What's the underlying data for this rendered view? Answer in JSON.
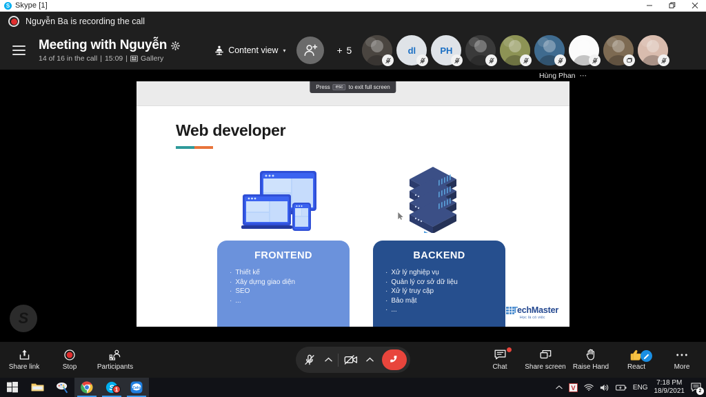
{
  "window": {
    "app_title": "Skype [1]",
    "app_badge": "S",
    "minimize": "–",
    "restore": "❐",
    "close": "✕"
  },
  "recording": {
    "text": "Nguyễn Ba is recording the call"
  },
  "header": {
    "title": "Meeting with Nguyễn",
    "subtitle_participants": "14 of 16 in the call",
    "subtitle_sep1": "|",
    "subtitle_time": "15:09",
    "subtitle_sep2": "|",
    "subtitle_view": "Gallery",
    "content_view_label": "Content view",
    "content_view_caret": "▾",
    "plus_count": "+ 5",
    "participants": [
      {
        "name": "participant-1",
        "type": "photo",
        "initials": "",
        "bg": "#4a4540",
        "muted": true
      },
      {
        "name": "participant-2",
        "type": "initials",
        "initials": "dl",
        "bg": "#dfe3e8",
        "muted": true
      },
      {
        "name": "participant-3",
        "type": "initials",
        "initials": "PH",
        "bg": "#dfe3e8",
        "muted": true
      },
      {
        "name": "participant-4",
        "type": "photo",
        "initials": "",
        "bg": "#3a3a3a",
        "muted": true
      },
      {
        "name": "participant-5",
        "type": "photo",
        "initials": "",
        "bg": "#8d9355",
        "muted": true
      },
      {
        "name": "participant-6",
        "type": "photo",
        "initials": "",
        "bg": "#3f6b8f",
        "muted": true
      },
      {
        "name": "participant-7",
        "type": "photo",
        "initials": "",
        "bg": "#fbfbfb",
        "muted": true
      },
      {
        "name": "participant-8",
        "type": "photo",
        "initials": "",
        "bg": "#7d6a52",
        "muted": false
      },
      {
        "name": "participant-9",
        "type": "photo",
        "initials": "",
        "bg": "#d9bcae",
        "muted": true
      }
    ],
    "active_speaker": "Hùng Phan",
    "active_speaker_more": "⋯"
  },
  "stage": {
    "esc_hint_prefix": "Press",
    "esc_key": "esc",
    "esc_hint_suffix": "to exit full screen",
    "skype_watermark": "S"
  },
  "slide": {
    "title": "Web developer",
    "frontend": {
      "heading": "FRONTEND",
      "items": [
        "Thiết kế",
        "Xây dựng giao diện",
        "SEO",
        "..."
      ],
      "color": "#6b92dc"
    },
    "backend": {
      "heading": "BACKEND",
      "items": [
        "Xử lý nghiệp vụ",
        "Quản lý cơ sở dữ liệu",
        "Xử lý truy cập",
        "Bảo mật",
        "..."
      ],
      "color": "#264f8e"
    },
    "bullet": "·",
    "logo": {
      "name_lead": "T",
      "name_rest": "echMaster",
      "tagline": "Học là có việc"
    },
    "accent_teal": "#2f9a9a",
    "accent_orange": "#e8743b"
  },
  "callbar": {
    "left": [
      {
        "icon": "share-link-icon",
        "label": "Share link"
      },
      {
        "icon": "stop-recording-icon",
        "label": "Stop"
      },
      {
        "icon": "participants-icon",
        "label": "Participants"
      }
    ],
    "right": [
      {
        "icon": "chat-icon",
        "label": "Chat",
        "badge": "dot"
      },
      {
        "icon": "share-screen-icon",
        "label": "Share screen",
        "badge": ""
      },
      {
        "icon": "raise-hand-icon",
        "label": "Raise Hand",
        "badge": ""
      },
      {
        "icon": "react-icon",
        "label": "React",
        "badge": "pencil"
      },
      {
        "icon": "more-icon",
        "label": "More",
        "badge": ""
      }
    ],
    "center": {
      "mic_state": "muted",
      "camera_state": "muted",
      "mic_caret": "⌃",
      "camera_caret": "⌃",
      "end_call": "end-call"
    }
  },
  "taskbar": {
    "items": [
      {
        "name": "start-button",
        "label": "",
        "badge": "",
        "active": false
      },
      {
        "name": "file-explorer",
        "label": "",
        "badge": "",
        "active": false
      },
      {
        "name": "paint",
        "label": "",
        "badge": "",
        "active": false
      },
      {
        "name": "chrome",
        "label": "",
        "badge": "",
        "active": true
      },
      {
        "name": "skype",
        "label": "",
        "badge": "1",
        "active": true
      },
      {
        "name": "zalo",
        "label": "",
        "badge": "",
        "active": true
      }
    ],
    "tray": {
      "overflow_caret": "⌃",
      "unikey": "V",
      "language": "ENG",
      "time": "7:18 PM",
      "date": "18/9/2021",
      "action_center_badge": "2"
    }
  }
}
